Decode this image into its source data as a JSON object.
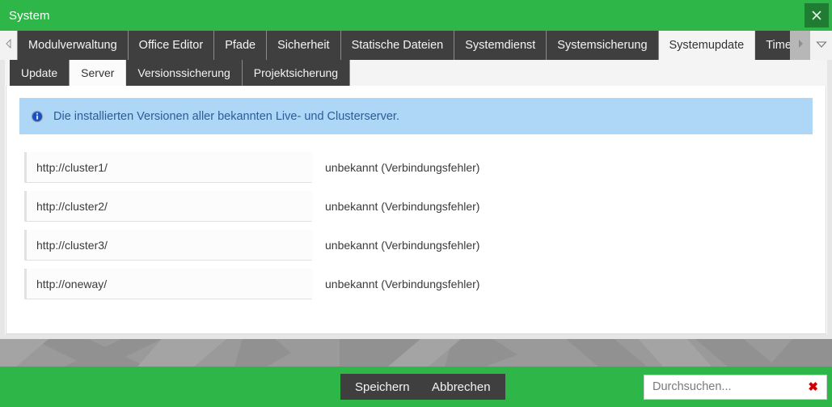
{
  "window": {
    "title": "System",
    "close_icon": "close-x-icon",
    "accent_green": "#2eb748",
    "close_button_bg": "#1f7c32",
    "tab_bg": "#3f3f3f",
    "info_bar_bg": "#aed6f7",
    "background_grey": "#9a9a9a"
  },
  "tabbar": {
    "scroll_left_icon": "chevron-left-icon",
    "scroll_right_icon": "chevron-right-icon",
    "dropdown_icon": "chevron-down-icon",
    "tabs": [
      {
        "label": "Modulverwaltung",
        "active": false
      },
      {
        "label": "Office Editor",
        "active": false
      },
      {
        "label": "Pfade",
        "active": false
      },
      {
        "label": "Sicherheit",
        "active": false
      },
      {
        "label": "Statische Dateien",
        "active": false
      },
      {
        "label": "Systemdienst",
        "active": false
      },
      {
        "label": "Systemsicherung",
        "active": false
      },
      {
        "label": "Systemupdate",
        "active": true
      },
      {
        "label": "Timeouts",
        "active": false
      }
    ]
  },
  "subtabs": [
    {
      "label": "Update",
      "active": false
    },
    {
      "label": "Server",
      "active": true
    },
    {
      "label": "Versionssicherung",
      "active": false
    },
    {
      "label": "Projektsicherung",
      "active": false
    }
  ],
  "info": {
    "icon": "info-circle-icon",
    "text": "Die installierten Versionen aller bekannten Live- und Clusterserver."
  },
  "servers": [
    {
      "url": "http://cluster1/",
      "status": "unbekannt (Verbindungsfehler)"
    },
    {
      "url": "http://cluster2/",
      "status": "unbekannt (Verbindungsfehler)"
    },
    {
      "url": "http://cluster3/",
      "status": "unbekannt (Verbindungsfehler)"
    },
    {
      "url": "http://oneway/",
      "status": "unbekannt (Verbindungsfehler)"
    }
  ],
  "footer": {
    "save_label": "Speichern",
    "cancel_label": "Abbrechen",
    "search_placeholder": "Durchsuchen...",
    "search_value": "",
    "search_clear_icon": "clear-x-icon",
    "search_clear_glyph": "✖"
  }
}
